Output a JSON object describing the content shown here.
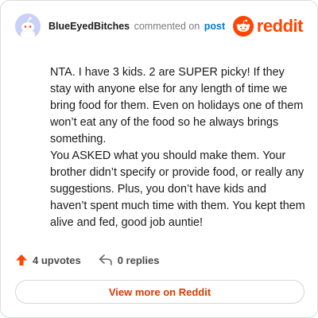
{
  "comment": {
    "username": "BlueEyedBitches",
    "action_text": "commented on",
    "post_link_text": "post",
    "paragraphs": [
      "NTA. I have 3 kids. 2 are SUPER picky! If they stay with anyone else for any length of time we bring food for them. Even on holidays one of them won’t eat any of the food so he always brings something.",
      "You ASKED what you should make them. Your brother didn’t specify or provide food, or really any suggestions. Plus, you don’t have kids and haven’t spent much time with them. You kept them alive and fed, good job auntie!"
    ]
  },
  "brand": {
    "wordmark": "reddit",
    "icon": "reddit-snoo-icon",
    "color": "#ff4500"
  },
  "avatar": {
    "icon": "default-snoo-avatar-icon",
    "background": "#c9d2f6"
  },
  "footer": {
    "upvotes_label": "4 upvotes",
    "upvote_icon": "upvote-arrow-icon",
    "upvote_color": "#ff4500",
    "replies_label": "0 replies",
    "reply_icon": "reply-arrow-icon"
  },
  "cta": {
    "label": "View more on Reddit",
    "color": "#d93a00"
  },
  "colors": {
    "link": "#0079d3",
    "muted": "#7c7c7c",
    "border": "#dadce0"
  }
}
